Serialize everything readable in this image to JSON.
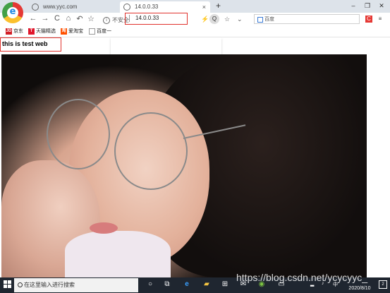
{
  "browser": {
    "tabs": [
      {
        "title": "www.yyc.com",
        "active": false
      },
      {
        "title": "14.0.0.33",
        "active": true,
        "close": "×"
      }
    ],
    "new_tab": "+",
    "window_controls": {
      "minimize": "–",
      "restore": "❐",
      "close": "✕"
    },
    "nav": {
      "back": "←",
      "forward": "→",
      "reload": "C",
      "home": "⌂",
      "undo": "↶",
      "favorite": "☆"
    },
    "security_label": "不安全",
    "address": "14.0.0.33",
    "zoom": "Q",
    "search_placeholder": "百度",
    "bookmarks": [
      {
        "label": "京东",
        "icon": "JD",
        "color": "#d21f26"
      },
      {
        "label": "天猫精选",
        "icon": "T",
        "color": "#e0162b"
      },
      {
        "label": "爱淘宝",
        "icon": "淘",
        "color": "#ff5000"
      },
      {
        "label": "百度一",
        "icon": "",
        "color": "#ffffff"
      }
    ]
  },
  "page": {
    "heading": "this is test web"
  },
  "taskbar": {
    "search_placeholder": "在这里输入进行搜索",
    "date": "2020/8/10",
    "notifications": "2"
  },
  "watermark": "https://blog.csdn.net/ycycyyc_",
  "colors": {
    "highlight": "#e0322d",
    "taskbar": "#1f2630"
  }
}
